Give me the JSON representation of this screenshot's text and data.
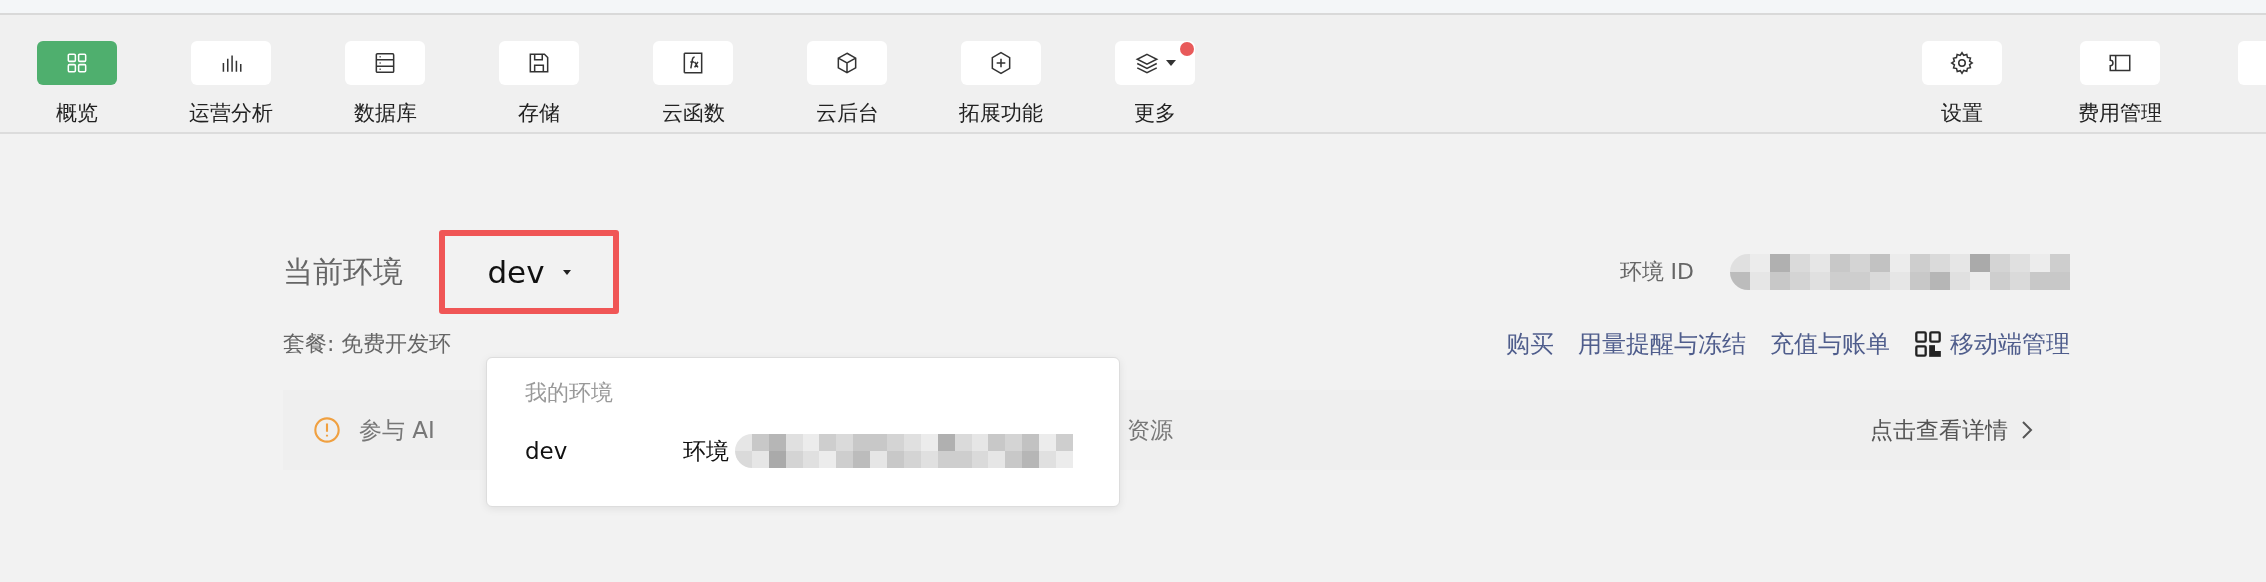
{
  "toolbar": {
    "items": [
      {
        "label": "概览",
        "selected": true,
        "has_menu": false,
        "badge": false
      },
      {
        "label": "运营分析",
        "selected": false,
        "has_menu": false,
        "badge": false
      },
      {
        "label": "数据库",
        "selected": false,
        "has_menu": false,
        "badge": false
      },
      {
        "label": "存储",
        "selected": false,
        "has_menu": false,
        "badge": false
      },
      {
        "label": "云函数",
        "selected": false,
        "has_menu": false,
        "badge": false
      },
      {
        "label": "云后台",
        "selected": false,
        "has_menu": false,
        "badge": false
      },
      {
        "label": "拓展功能",
        "selected": false,
        "has_menu": false,
        "badge": false
      },
      {
        "label": "更多",
        "selected": false,
        "has_menu": true,
        "badge": true
      }
    ],
    "right_items": [
      {
        "label": "设置"
      },
      {
        "label": "费用管理"
      }
    ]
  },
  "environment": {
    "label": "当前环境",
    "selector": {
      "value": "dev",
      "highlighted": true,
      "expanded": true
    },
    "id_label": "环境 ID",
    "plan": "套餐: 免费开发环",
    "links": [
      "购买",
      "用量提醒与冻结",
      "充值与账单",
      "移动端管理"
    ],
    "dropdown": {
      "header": "我的环境",
      "options": [
        {
          "name": "dev",
          "detail": "环境"
        }
      ]
    }
  },
  "notice": {
    "text_start": "参与 AI",
    "text_end": "资源",
    "action": "点击查看详情"
  }
}
